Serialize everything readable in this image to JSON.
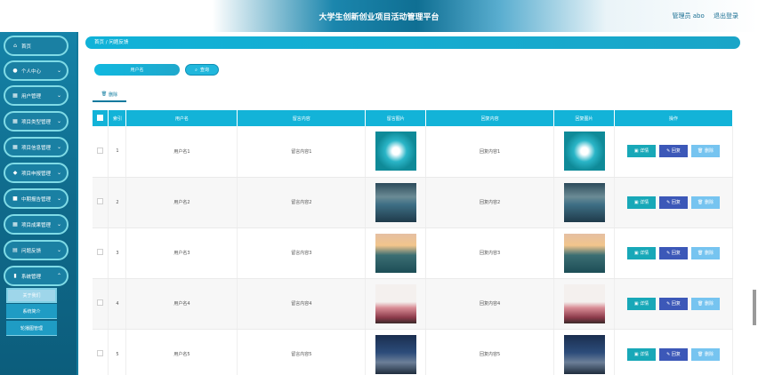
{
  "header": {
    "title": "大学生创新创业项目活动管理平台",
    "user_label": "管理员 abo",
    "logout_label": "退出登录"
  },
  "sidebar": {
    "items": [
      {
        "label": "首页",
        "icon": "home-icon"
      },
      {
        "label": "个人中心",
        "icon": "user-icon"
      },
      {
        "label": "用户管理",
        "icon": "grid-icon"
      },
      {
        "label": "项目类型管理",
        "icon": "grid-icon"
      },
      {
        "label": "项目信息管理",
        "icon": "grid-icon"
      },
      {
        "label": "项目申报管理",
        "icon": "pin-icon"
      },
      {
        "label": "中期报告管理",
        "icon": "folder-icon"
      },
      {
        "label": "项目成果管理",
        "icon": "grid-icon"
      },
      {
        "label": "问题反馈",
        "icon": "doc-icon"
      },
      {
        "label": "系统管理",
        "icon": "bar-chart-icon"
      }
    ],
    "subitems": [
      {
        "label": "关于我们"
      },
      {
        "label": "系统简介"
      },
      {
        "label": "轮播图管理"
      }
    ]
  },
  "main": {
    "breadcrumb": "首页 / 问题反馈",
    "search": {
      "placeholder": "用户名",
      "button_label": "查询"
    },
    "delete_tab_label": "删除",
    "table": {
      "headers": [
        "",
        "索引",
        "用户名",
        "留言内容",
        "留言图片",
        "回复内容",
        "回复图片",
        "操作"
      ],
      "rows": [
        {
          "index": "1",
          "user": "用户名1",
          "content": "留言内容1",
          "reply": "回复内容1",
          "image": "flower"
        },
        {
          "index": "2",
          "user": "用户名2",
          "content": "留言内容2",
          "reply": "回复内容2",
          "image": "river"
        },
        {
          "index": "3",
          "user": "用户名3",
          "content": "留言内容3",
          "reply": "回复内容3",
          "image": "boat"
        },
        {
          "index": "4",
          "user": "用户名4",
          "content": "留言内容4",
          "reply": "回复内容4",
          "image": "vase"
        },
        {
          "index": "5",
          "user": "用户名5",
          "content": "留言内容5",
          "reply": "回复内容5",
          "image": "lake"
        }
      ],
      "actions": {
        "detail": "详情",
        "reply": "回复",
        "delete": "删除"
      }
    }
  },
  "colors": {
    "accent": "#13b3d8",
    "sidebar": "#1583a8",
    "reply_button": "#3c58b8"
  }
}
